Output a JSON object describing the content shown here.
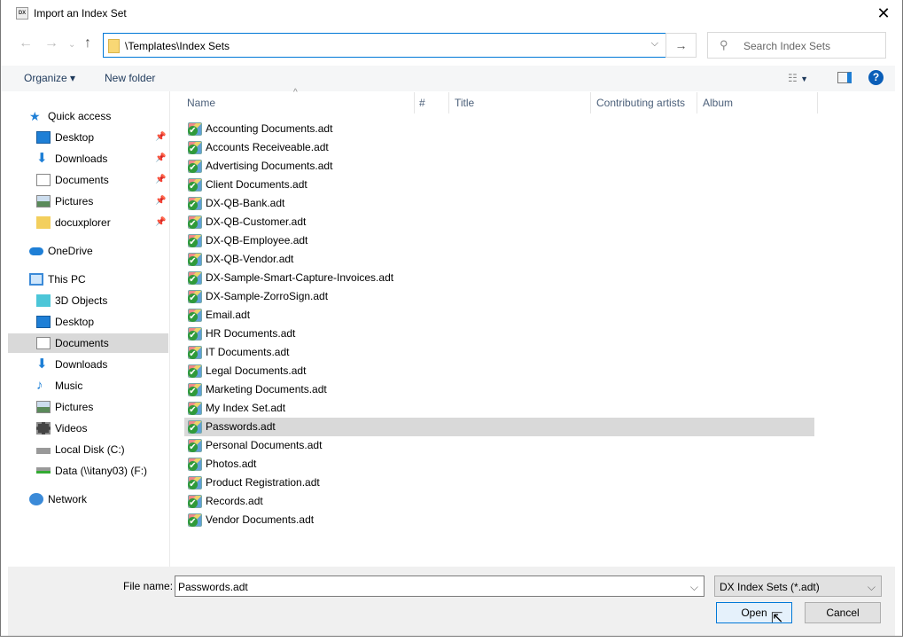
{
  "window": {
    "title": "Import an Index Set",
    "app_icon": "DX"
  },
  "nav": {
    "address": "\\Templates\\Index Sets",
    "search_placeholder": "Search Index Sets"
  },
  "toolbar": {
    "organize": "Organize ▾",
    "new_folder": "New folder"
  },
  "columns": [
    "Name",
    "#",
    "Title",
    "Contributing artists",
    "Album"
  ],
  "sidebar": [
    {
      "label": "Quick access",
      "icon": "star-icon",
      "level": 0
    },
    {
      "label": "Desktop",
      "icon": "desktop-icon",
      "level": 1,
      "pinned": true
    },
    {
      "label": "Downloads",
      "icon": "download-icon",
      "level": 1,
      "pinned": true
    },
    {
      "label": "Documents",
      "icon": "document-icon",
      "level": 1,
      "pinned": true
    },
    {
      "label": "Pictures",
      "icon": "pictures-icon",
      "level": 1,
      "pinned": true
    },
    {
      "label": "docuxplorer",
      "icon": "folder-warning-icon",
      "level": 1,
      "pinned": true
    },
    {
      "label": "OneDrive",
      "icon": "cloud-icon",
      "level": 0
    },
    {
      "label": "This PC",
      "icon": "computer-icon",
      "level": 0
    },
    {
      "label": "3D Objects",
      "icon": "cube-icon",
      "level": 1
    },
    {
      "label": "Desktop",
      "icon": "desktop-icon",
      "level": 1
    },
    {
      "label": "Documents",
      "icon": "document-icon",
      "level": 1,
      "selected": true
    },
    {
      "label": "Downloads",
      "icon": "download-icon",
      "level": 1
    },
    {
      "label": "Music",
      "icon": "music-icon",
      "level": 1
    },
    {
      "label": "Pictures",
      "icon": "pictures-icon",
      "level": 1
    },
    {
      "label": "Videos",
      "icon": "video-icon",
      "level": 1
    },
    {
      "label": "Local Disk (C:)",
      "icon": "disk-icon",
      "level": 1
    },
    {
      "label": "Data (\\\\itany03) (F:)",
      "icon": "network-drive-icon",
      "level": 1
    },
    {
      "label": "Network",
      "icon": "network-icon",
      "level": 0
    }
  ],
  "files": [
    "Accounting Documents.adt",
    "Accounts Receiveable.adt",
    "Advertising Documents.adt",
    "Client Documents.adt",
    "DX-QB-Bank.adt",
    "DX-QB-Customer.adt",
    "DX-QB-Employee.adt",
    "DX-QB-Vendor.adt",
    "DX-Sample-Smart-Capture-Invoices.adt",
    "DX-Sample-ZorroSign.adt",
    "Email.adt",
    "HR Documents.adt",
    "IT Documents.adt",
    "Legal Documents.adt",
    "Marketing Documents.adt",
    "My Index Set.adt",
    "Passwords.adt",
    "Personal Documents.adt",
    "Photos.adt",
    "Product Registration.adt",
    "Records.adt",
    "Vendor Documents.adt"
  ],
  "selected_file": "Passwords.adt",
  "footer": {
    "file_name_label": "File name:",
    "file_name": "Passwords.adt",
    "filter": "DX Index Sets (*.adt)",
    "open": "Open",
    "cancel": "Cancel"
  }
}
